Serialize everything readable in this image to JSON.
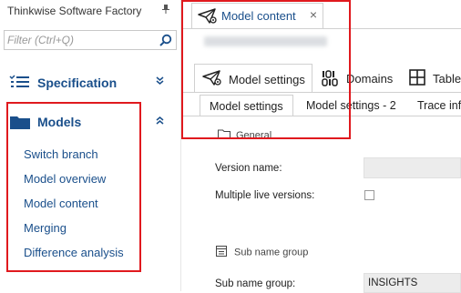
{
  "sidebar": {
    "app_title": "Thinkwise Software Factory",
    "filter_placeholder": "Filter (Ctrl+Q)",
    "specification_label": "Specification",
    "models_label": "Models",
    "model_items": [
      "Switch branch",
      "Model overview",
      "Model content",
      "Merging",
      "Difference analysis"
    ]
  },
  "document_tab": {
    "label": "Model content",
    "close_glyph": "×"
  },
  "ribbon": {
    "tabs": [
      "Model settings",
      "Domains",
      "Tables"
    ]
  },
  "subtabs": [
    "Model settings",
    "Model settings - 2",
    "Trace info"
  ],
  "form": {
    "group_general": "General",
    "version_name_label": "Version name:",
    "version_name_value": "",
    "multiple_live_versions_label": "Multiple live versions:",
    "multiple_live_versions_checked": false,
    "group_sub_name": "Sub name group",
    "sub_name_group_label": "Sub name group:",
    "sub_name_group_value": "INSIGHTS"
  },
  "colors": {
    "accent": "#1a4f8b",
    "highlight_box": "#e0191e"
  }
}
